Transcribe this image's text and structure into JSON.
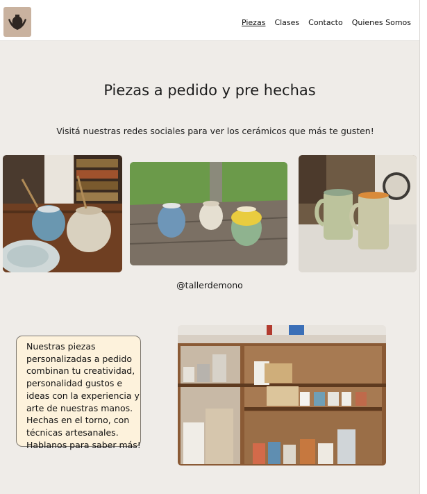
{
  "nav": {
    "items": [
      {
        "label": "Piezas",
        "active": true
      },
      {
        "label": "Clases",
        "active": false
      },
      {
        "label": "Contacto",
        "active": false
      },
      {
        "label": "Quienes Somos",
        "active": false
      }
    ]
  },
  "logo": {
    "icon": "vase-in-hands-icon"
  },
  "main": {
    "title": "Piezas a pedido y pre hechas",
    "subtitle": "Visitá nuestras redes sociales para ver los cerámicos que más te gusten!",
    "handle": "@tallerdemono",
    "info_lines": [
      "Nuestras piezas",
      "personalizadas a pedido",
      "combinan tu creatividad,",
      "personalidad gustos e",
      "ideas con la experiencia y",
      "arte de nuestras manos.",
      "Hechas en el torno, con",
      "técnicas artesanales.",
      "Hablanos para saber más!"
    ]
  },
  "colors": {
    "page_bg": "#efece8",
    "nav_bg": "#ffffff",
    "info_bg": "#fdf2dc",
    "logo_bg": "#c9b29f"
  }
}
